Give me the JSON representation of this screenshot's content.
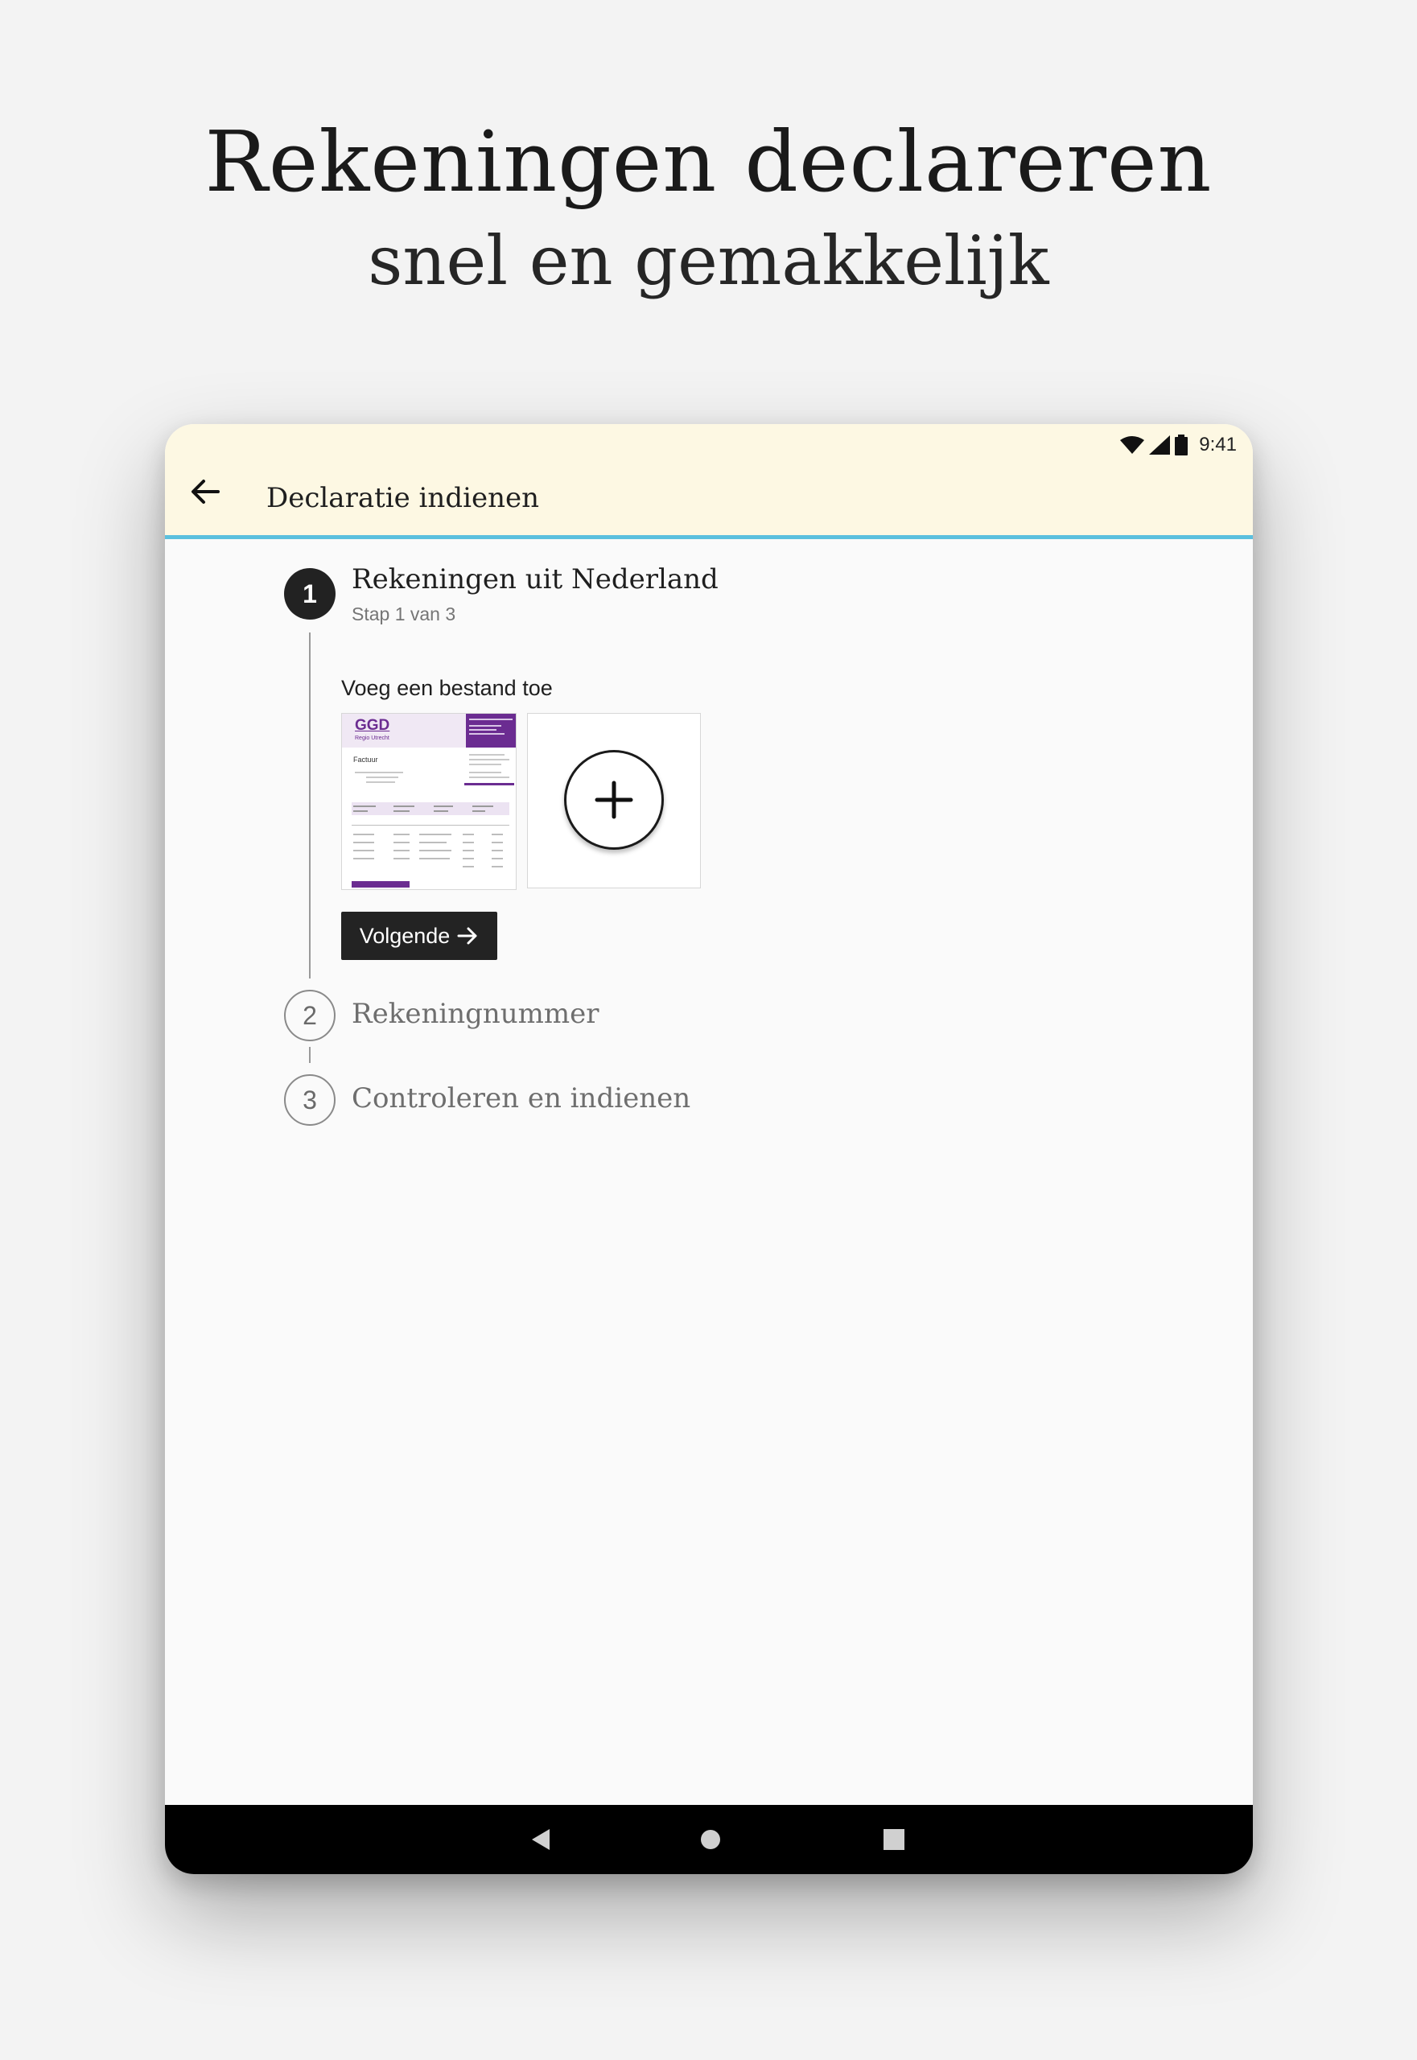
{
  "headline": {
    "title": "Rekeningen declareren",
    "subtitle": "snel en gemakkelijk"
  },
  "status_bar": {
    "time": "9:41",
    "icons": [
      "wifi-icon",
      "signal-icon",
      "battery-icon"
    ]
  },
  "app_bar": {
    "back_icon": "arrow-back-icon",
    "title": "Declaratie indienen",
    "accent_color": "#5bc0de",
    "background_color": "#fdf8e3"
  },
  "stepper": {
    "steps": [
      {
        "number": "1",
        "title": "Rekeningen uit Nederland",
        "subtitle": "Stap 1 van 3",
        "state": "active"
      },
      {
        "number": "2",
        "title": "Rekeningnummer",
        "state": "inactive"
      },
      {
        "number": "3",
        "title": "Controleren en indienen",
        "state": "inactive"
      }
    ]
  },
  "upload": {
    "label": "Voeg een bestand toe",
    "attachments": [
      {
        "type": "invoice-thumbnail",
        "logo": "GGD",
        "logo_sub": "Regio Utrecht",
        "heading": "Factuur",
        "brand_color": "#6b2c91"
      }
    ],
    "add_icon": "plus-icon"
  },
  "next_button": {
    "label": "Volgende",
    "icon": "arrow-forward-icon"
  },
  "nav_bar": {
    "buttons": [
      "back-triangle-icon",
      "home-circle-icon",
      "recents-square-icon"
    ]
  }
}
